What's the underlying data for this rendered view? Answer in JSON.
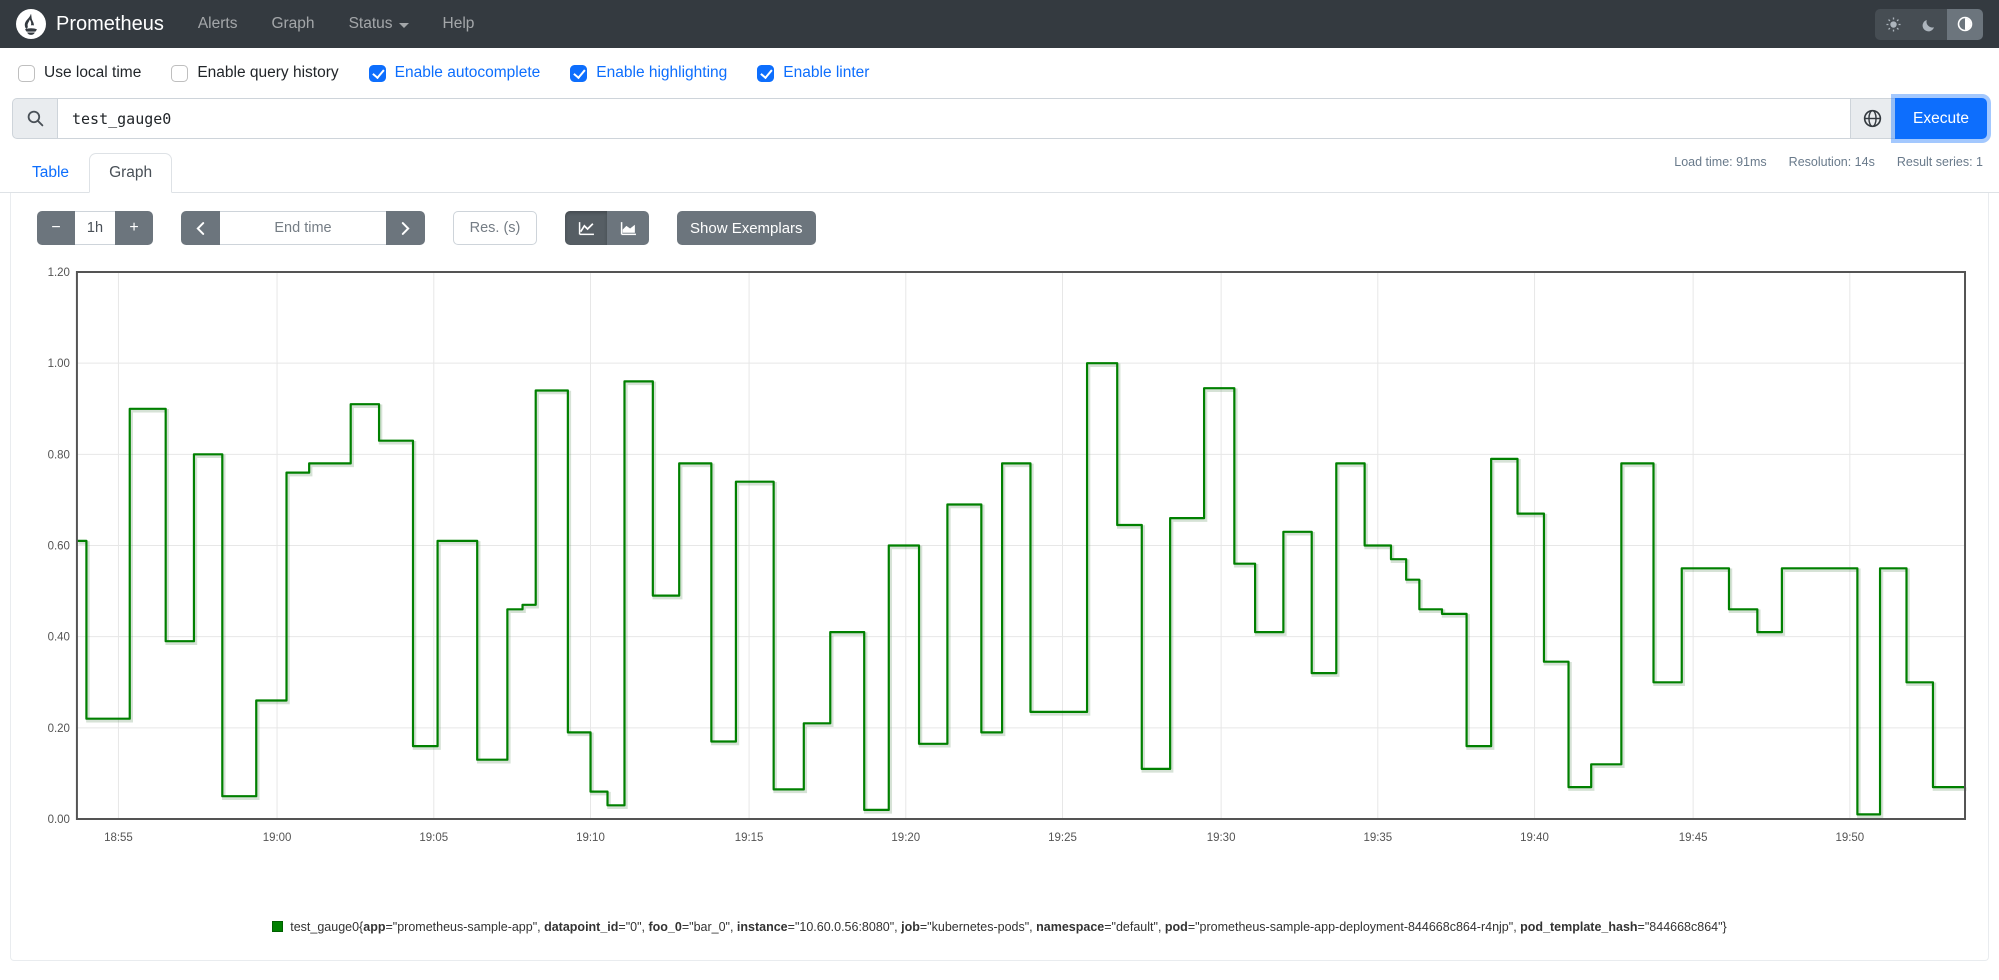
{
  "navbar": {
    "brand": "Prometheus",
    "items": [
      {
        "label": "Alerts",
        "dropdown": false
      },
      {
        "label": "Graph",
        "dropdown": false
      },
      {
        "label": "Status",
        "dropdown": true
      },
      {
        "label": "Help",
        "dropdown": false
      }
    ],
    "theme_toggle": {
      "options": [
        "light",
        "dark",
        "auto"
      ],
      "active_index": 2
    }
  },
  "options": {
    "items": [
      {
        "label": "Use local time",
        "checked": false
      },
      {
        "label": "Enable query history",
        "checked": false
      },
      {
        "label": "Enable autocomplete",
        "checked": true
      },
      {
        "label": "Enable highlighting",
        "checked": true
      },
      {
        "label": "Enable linter",
        "checked": true
      }
    ]
  },
  "query": {
    "value": "test_gauge0",
    "execute_label": "Execute",
    "stats": {
      "load_time": "Load time: 91ms",
      "resolution": "Resolution: 14s",
      "result_series": "Result series: 1"
    }
  },
  "tabs": [
    {
      "label": "Table",
      "active": false
    },
    {
      "label": "Graph",
      "active": true
    }
  ],
  "graph_controls": {
    "decrease_label": "−",
    "range_value": "1h",
    "increase_label": "+",
    "end_time_placeholder": "End time",
    "res_placeholder": "Res. (s)",
    "show_exemplars_label": "Show Exemplars"
  },
  "chart_data": {
    "type": "line",
    "step": true,
    "title": "",
    "xlabel": "",
    "ylabel": "",
    "ylim": [
      0.0,
      1.2
    ],
    "y_ticks": [
      "0.00",
      "0.20",
      "0.40",
      "0.60",
      "0.80",
      "1.00",
      "1.20"
    ],
    "x_tick_labels": [
      "18:55",
      "19:00",
      "19:05",
      "19:10",
      "19:15",
      "19:20",
      "19:25",
      "19:30",
      "19:35",
      "19:40",
      "19:45",
      "19:50"
    ],
    "x_tick_fracs": [
      0.022,
      0.106,
      0.189,
      0.272,
      0.356,
      0.439,
      0.522,
      0.606,
      0.689,
      0.772,
      0.856,
      0.939
    ],
    "grid": true,
    "legend_position": "bottom",
    "line_color": "#008000",
    "series": [
      {
        "name": "test_gauge0",
        "color": "#008000",
        "points": [
          [
            0.0,
            0.61
          ],
          [
            0.005,
            0.22
          ],
          [
            0.028,
            0.9
          ],
          [
            0.047,
            0.39
          ],
          [
            0.062,
            0.8
          ],
          [
            0.077,
            0.05
          ],
          [
            0.095,
            0.26
          ],
          [
            0.111,
            0.76
          ],
          [
            0.123,
            0.78
          ],
          [
            0.145,
            0.91
          ],
          [
            0.16,
            0.83
          ],
          [
            0.178,
            0.16
          ],
          [
            0.191,
            0.61
          ],
          [
            0.212,
            0.13
          ],
          [
            0.228,
            0.46
          ],
          [
            0.236,
            0.47
          ],
          [
            0.243,
            0.94
          ],
          [
            0.26,
            0.19
          ],
          [
            0.272,
            0.06
          ],
          [
            0.281,
            0.03
          ],
          [
            0.29,
            0.96
          ],
          [
            0.305,
            0.49
          ],
          [
            0.319,
            0.78
          ],
          [
            0.336,
            0.17
          ],
          [
            0.349,
            0.74
          ],
          [
            0.369,
            0.065
          ],
          [
            0.385,
            0.21
          ],
          [
            0.399,
            0.41
          ],
          [
            0.417,
            0.02
          ],
          [
            0.43,
            0.6
          ],
          [
            0.446,
            0.165
          ],
          [
            0.461,
            0.69
          ],
          [
            0.479,
            0.19
          ],
          [
            0.49,
            0.78
          ],
          [
            0.505,
            0.235
          ],
          [
            0.535,
            1.0
          ],
          [
            0.551,
            0.645
          ],
          [
            0.564,
            0.11
          ],
          [
            0.579,
            0.66
          ],
          [
            0.597,
            0.945
          ],
          [
            0.613,
            0.56
          ],
          [
            0.624,
            0.41
          ],
          [
            0.639,
            0.63
          ],
          [
            0.654,
            0.32
          ],
          [
            0.667,
            0.78
          ],
          [
            0.682,
            0.6
          ],
          [
            0.696,
            0.57
          ],
          [
            0.704,
            0.525
          ],
          [
            0.711,
            0.46
          ],
          [
            0.723,
            0.45
          ],
          [
            0.736,
            0.16
          ],
          [
            0.749,
            0.79
          ],
          [
            0.763,
            0.67
          ],
          [
            0.777,
            0.345
          ],
          [
            0.79,
            0.07
          ],
          [
            0.802,
            0.12
          ],
          [
            0.818,
            0.78
          ],
          [
            0.835,
            0.3
          ],
          [
            0.85,
            0.55
          ],
          [
            0.875,
            0.46
          ],
          [
            0.89,
            0.41
          ],
          [
            0.903,
            0.55
          ],
          [
            0.943,
            0.01
          ],
          [
            0.955,
            0.55
          ],
          [
            0.969,
            0.3
          ],
          [
            0.983,
            0.07
          ]
        ]
      }
    ]
  },
  "legend": {
    "metric": "test_gauge0",
    "labels": [
      {
        "name": "app",
        "value": "prometheus-sample-app"
      },
      {
        "name": "datapoint_id",
        "value": "0"
      },
      {
        "name": "foo_0",
        "value": "bar_0"
      },
      {
        "name": "instance",
        "value": "10.60.0.56:8080"
      },
      {
        "name": "job",
        "value": "kubernetes-pods"
      },
      {
        "name": "namespace",
        "value": "default"
      },
      {
        "name": "pod",
        "value": "prometheus-sample-app-deployment-844668c864-r4njp"
      },
      {
        "name": "pod_template_hash",
        "value": "844668c864"
      }
    ]
  }
}
